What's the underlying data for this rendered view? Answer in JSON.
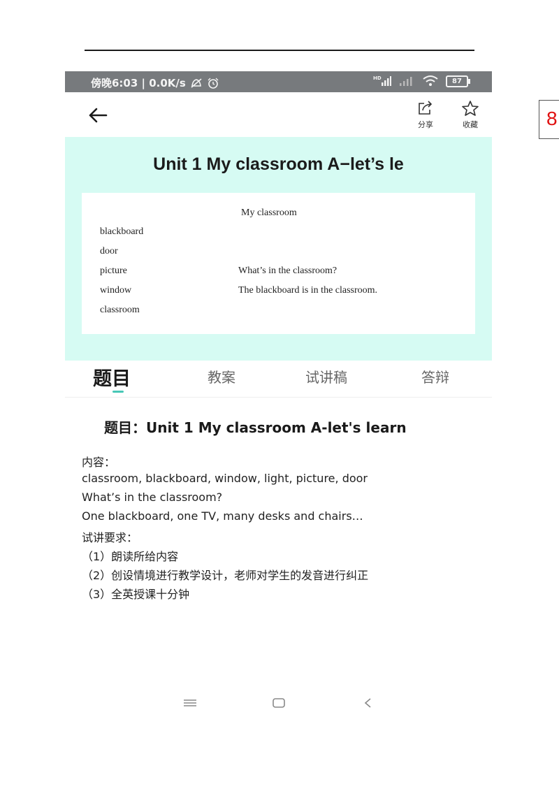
{
  "page_number": "8",
  "status_bar": {
    "time_speed": "傍晚6:03 | 0.0K/s",
    "network_label": "HD",
    "battery": "87"
  },
  "header": {
    "share_label": "分享",
    "favorite_label": "收藏"
  },
  "banner": {
    "title": "Unit 1 My classroom A−let’s le",
    "slide": {
      "heading": "My    classroom",
      "words": [
        "blackboard",
        "door",
        "picture",
        "window",
        "classroom"
      ],
      "question": "What’s in the classroom?",
      "answer": "The blackboard is in the classroom."
    }
  },
  "tabs": [
    {
      "label": "题目",
      "active": true
    },
    {
      "label": "教案",
      "active": false
    },
    {
      "label": "试讲稿",
      "active": false
    },
    {
      "label": "答辩",
      "active": false
    }
  ],
  "content": {
    "title": "题目：Unit 1 My classroom A-let's learn",
    "lines": [
      "内容：",
      "classroom, blackboard, window, light, picture, door",
      "What’s in the classroom?",
      "One blackboard, one TV, many desks and chairs…",
      "试讲要求：",
      "（1）朗读所给内容",
      "（2）创设情境进行教学设计，老师对学生的发音进行纠正",
      "（3）全英授课十分钟"
    ]
  },
  "icons": {
    "back": "arrow-left",
    "share": "share-square",
    "favorite": "star-outline",
    "menu": "hamburger-lines",
    "home": "rounded-square",
    "back_nav": "chevron-left"
  },
  "colors": {
    "status_bar_bg": "#777a7d",
    "banner_bg": "#d6fbf3",
    "tab_indicator": "#47c7b6",
    "page_number": "#e01010"
  }
}
